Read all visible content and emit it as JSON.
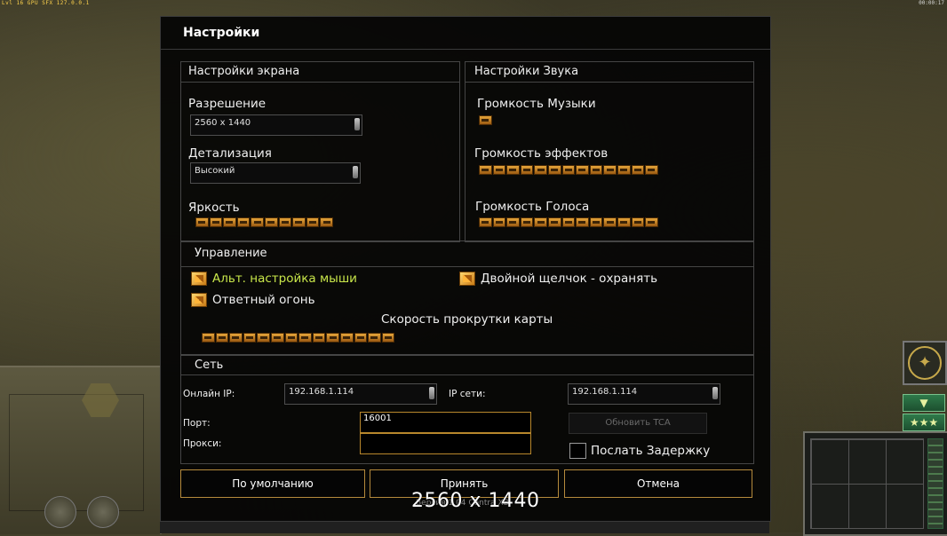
{
  "hud": {
    "top_left": "Lvl 16 GPU SFX 127.0.0.1",
    "top_right": "00:00:17"
  },
  "dialog": {
    "title": "Настройки",
    "screen": {
      "heading": "Настройки экрана",
      "resolution_label": "Разрешение",
      "resolution_value": "2560 x 1440",
      "detail_label": "Детализация",
      "detail_value": "Высокий",
      "brightness_label": "Яркость",
      "brightness_level": 10,
      "brightness_max": 10
    },
    "sound": {
      "heading": "Настройки Звука",
      "music_label": "Громкость Музыки",
      "music_level": 1,
      "effects_label": "Громкость эффектов",
      "effects_level": 13,
      "voice_label": "Громкость Голоса",
      "voice_level": 13
    },
    "control": {
      "heading": "Управление",
      "alt_mouse_label": "Альт. настройка мыши",
      "alt_mouse_checked": true,
      "double_click_label": "Двойной щелчок - охранять",
      "double_click_checked": true,
      "return_fire_label": "Ответный огонь",
      "return_fire_checked": true,
      "scroll_label": "Скорость прокрутки карты",
      "scroll_level": 14
    },
    "network": {
      "heading": "Сеть",
      "online_ip_label": "Онлайн IP:",
      "online_ip_value": "192.168.1.114",
      "lan_ip_label": "IP сети:",
      "lan_ip_value": "192.168.1.114",
      "port_label": "Порт:",
      "port_value": "16001",
      "proxy_label": "Прокси:",
      "proxy_value": "",
      "update_tca_label": "Обновить TCA",
      "send_delay_label": "Послать Задержку",
      "send_delay_checked": false
    },
    "buttons": {
      "defaults": "По умолчанию",
      "accept": "Принять",
      "cancel": "Отмена"
    }
  },
  "overlay": {
    "resolution_text": "2560 x 1440",
    "version_text": "Версия 1.04 Contra XB"
  },
  "colors": {
    "accent": "#b58a3c",
    "highlight_text": "#c8e64a",
    "slider": "#e5a53a"
  }
}
